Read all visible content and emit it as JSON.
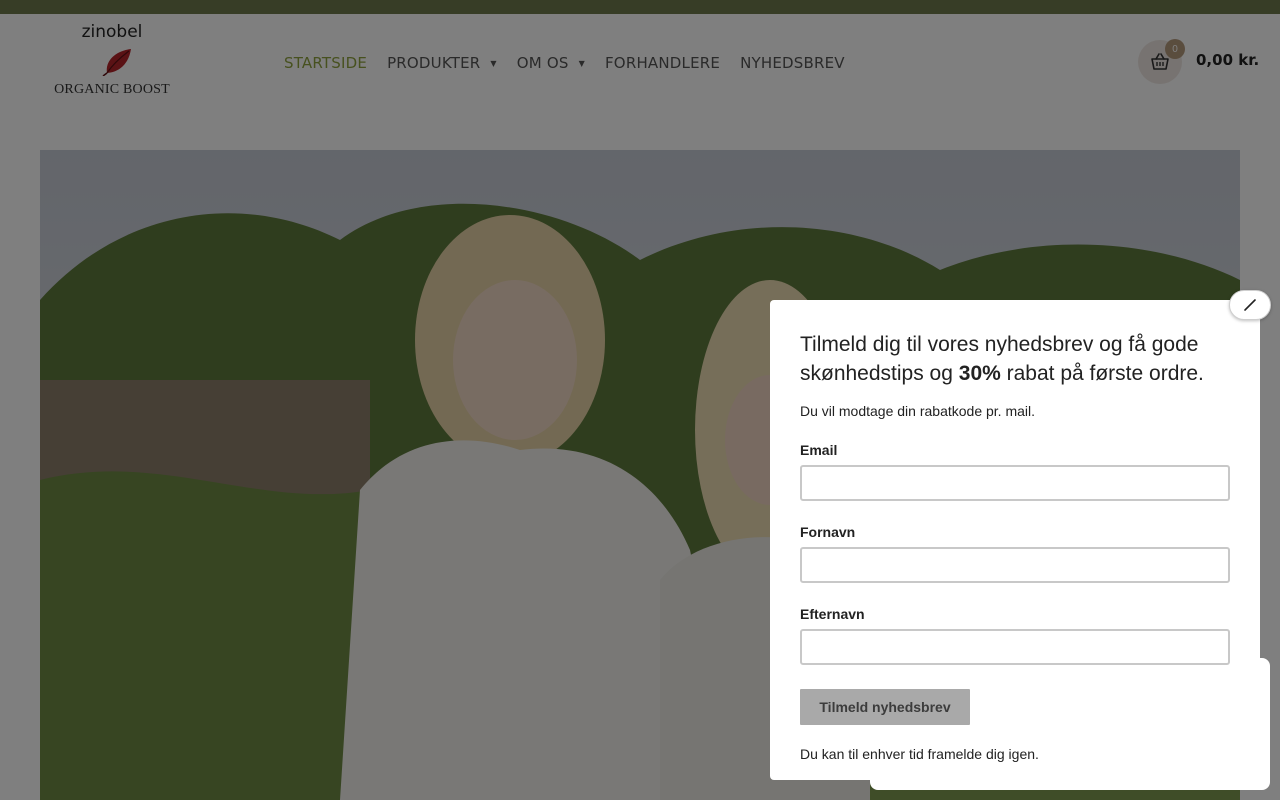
{
  "logo": {
    "wordmark": "zinobel",
    "subtitle": "ORGANIC BOOST"
  },
  "nav": {
    "items": [
      {
        "label": "STARTSIDE",
        "active": true,
        "has_dropdown": false
      },
      {
        "label": "PRODUKTER",
        "active": false,
        "has_dropdown": true
      },
      {
        "label": "OM OS",
        "active": false,
        "has_dropdown": true
      },
      {
        "label": "FORHANDLERE",
        "active": false,
        "has_dropdown": false
      },
      {
        "label": "NYHEDSBREV",
        "active": false,
        "has_dropdown": false
      }
    ],
    "caret": "▼"
  },
  "cart": {
    "count": "0",
    "total": "0,00 kr.",
    "icon": "basket-icon"
  },
  "popup": {
    "title_part1": "Tilmeld dig til vores nyhedsbrev og få gode skønhedstips og ",
    "title_bold": "30%",
    "title_part2": " rabat på første ordre.",
    "subtitle": "Du vil modtage din rabatkode pr. mail.",
    "fields": [
      {
        "label": "Email",
        "value": "",
        "placeholder": ""
      },
      {
        "label": "Fornavn",
        "value": "",
        "placeholder": ""
      },
      {
        "label": "Efternavn",
        "value": "",
        "placeholder": ""
      }
    ],
    "submit_label": "Tilmeld nyhedsbrev",
    "footer": "Du kan til enhver tid framelde dig igen.",
    "close_icon": "close-icon"
  },
  "colors": {
    "accent_green": "#8fa23e",
    "topbar": "#6f7a4d",
    "cart_badge": "#b59a7d",
    "logo_leaf": "#b5252a",
    "submit_disabled": "#a9a9a9"
  }
}
